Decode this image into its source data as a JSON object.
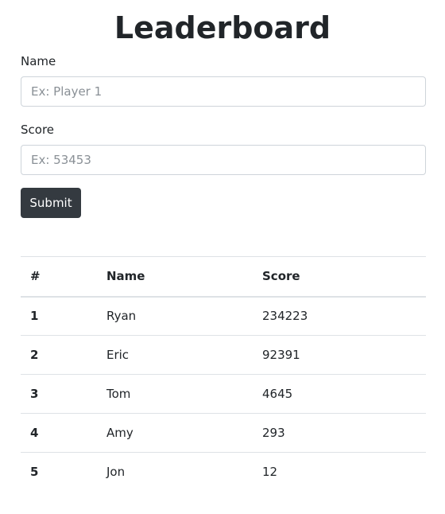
{
  "page": {
    "title": "Leaderboard"
  },
  "form": {
    "name_label": "Name",
    "name_placeholder": "Ex: Player 1",
    "score_label": "Score",
    "score_placeholder": "Ex: 53453",
    "submit_label": "Submit"
  },
  "table": {
    "headers": {
      "rank": "#",
      "name": "Name",
      "score": "Score"
    },
    "rows": [
      {
        "rank": "1",
        "name": "Ryan",
        "score": "234223"
      },
      {
        "rank": "2",
        "name": "Eric",
        "score": "92391"
      },
      {
        "rank": "3",
        "name": "Tom",
        "score": "4645"
      },
      {
        "rank": "4",
        "name": "Amy",
        "score": "293"
      },
      {
        "rank": "5",
        "name": "Jon",
        "score": "12"
      }
    ]
  },
  "colors": {
    "button_bg": "#343a40",
    "text": "#212529",
    "border": "#dee2e6",
    "input_border": "#ced4da"
  }
}
